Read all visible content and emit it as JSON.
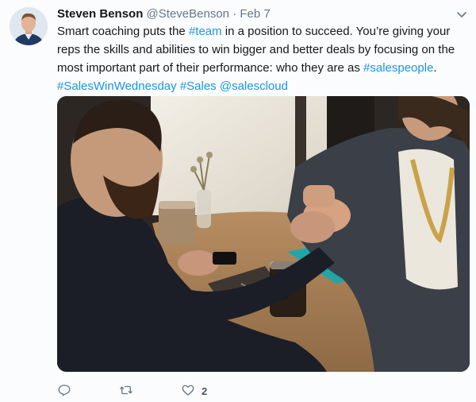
{
  "tweet": {
    "author_name": "Steven Benson",
    "author_handle": "@SteveBenson",
    "separator": "·",
    "date": "Feb 7",
    "text_parts": [
      "Smart coaching puts the ",
      "#team",
      " in a position to succeed. You’re giving your reps the skills and abilities to win bigger and better deals by focusing on the most important part of their performance: who they are as ",
      "#salespeople",
      "."
    ],
    "tags": [
      "#SalesWinWednesday",
      "#Sales",
      "@salescloud"
    ],
    "media_icon": "photo-handshake",
    "actions": {
      "reply_icon": "reply-icon",
      "retweet_icon": "retweet-icon",
      "like_icon": "heart-icon",
      "like_count": "2"
    }
  },
  "colors": {
    "link": "#1b95e0",
    "text": "#14171a",
    "muted": "#657786"
  }
}
